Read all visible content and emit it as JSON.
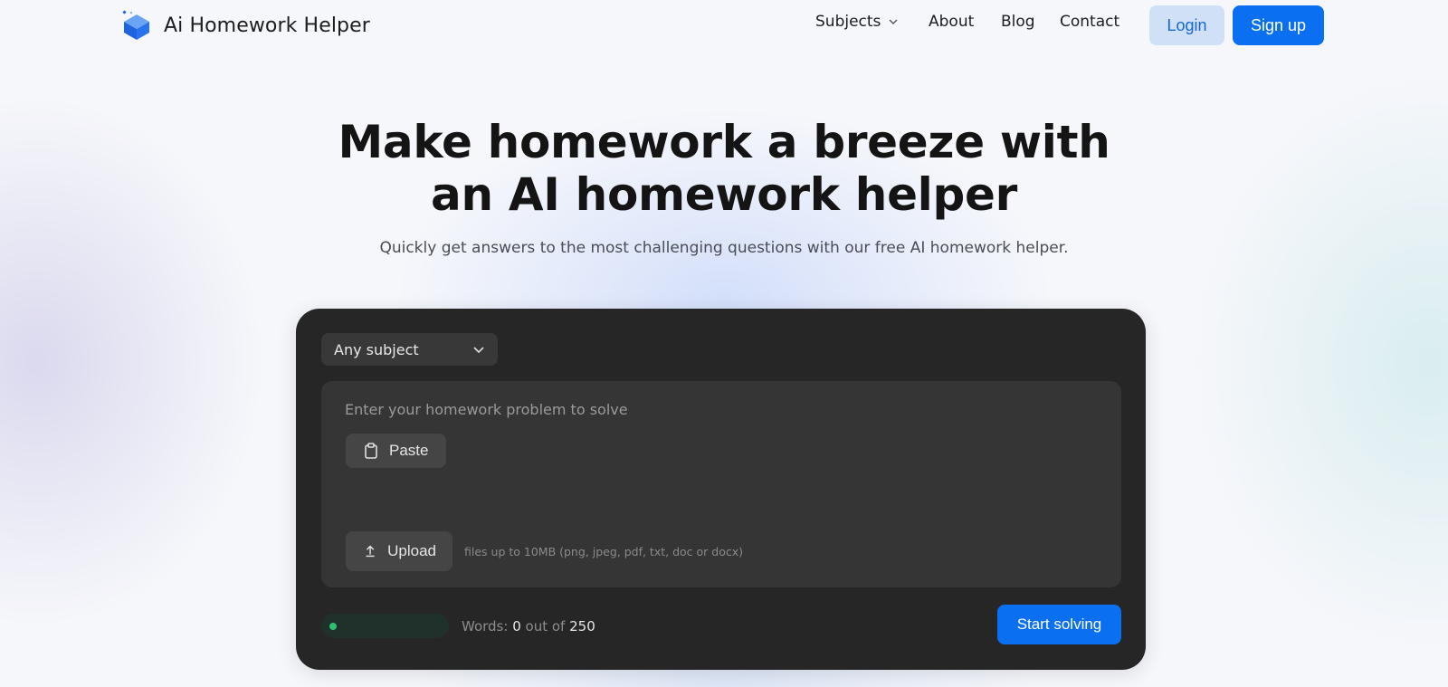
{
  "nav": {
    "brand": {
      "name": "Ai Homework Helper",
      "logo_icon": "book-sparkle-icon"
    },
    "links": [
      {
        "label": "Subjects",
        "has_dropdown": true
      },
      {
        "label": "About"
      },
      {
        "label": "Blog"
      },
      {
        "label": "Contact"
      }
    ],
    "login_label": "Login",
    "signup_label": "Sign up"
  },
  "hero": {
    "title_line1": "Make homework a breeze with",
    "title_line2": "an AI homework helper",
    "subtitle": "Quickly get answers to the most challenging questions with our free AI homework helper."
  },
  "solver": {
    "subject_select": {
      "value": "Any subject",
      "icon": "chevron-down-icon"
    },
    "input": {
      "placeholder": "Enter your homework problem to solve",
      "value": ""
    },
    "paste_label": "Paste",
    "paste_icon": "clipboard-icon",
    "upload_label": "Upload",
    "upload_icon": "upload-arrow-icon",
    "upload_hint": "files up to 10MB (png, jpeg, pdf, txt, doc or docx)",
    "words": {
      "prefix": "Words:",
      "current": "0",
      "middle": "out of",
      "max": "250",
      "progress": 0
    },
    "start_label": "Start solving"
  },
  "colors": {
    "accent": "#0a6ff0",
    "login_bg": "#cfe0f7",
    "panel_bg": "#262626",
    "input_bg": "#353535",
    "progress_green": "#2fbf71"
  }
}
